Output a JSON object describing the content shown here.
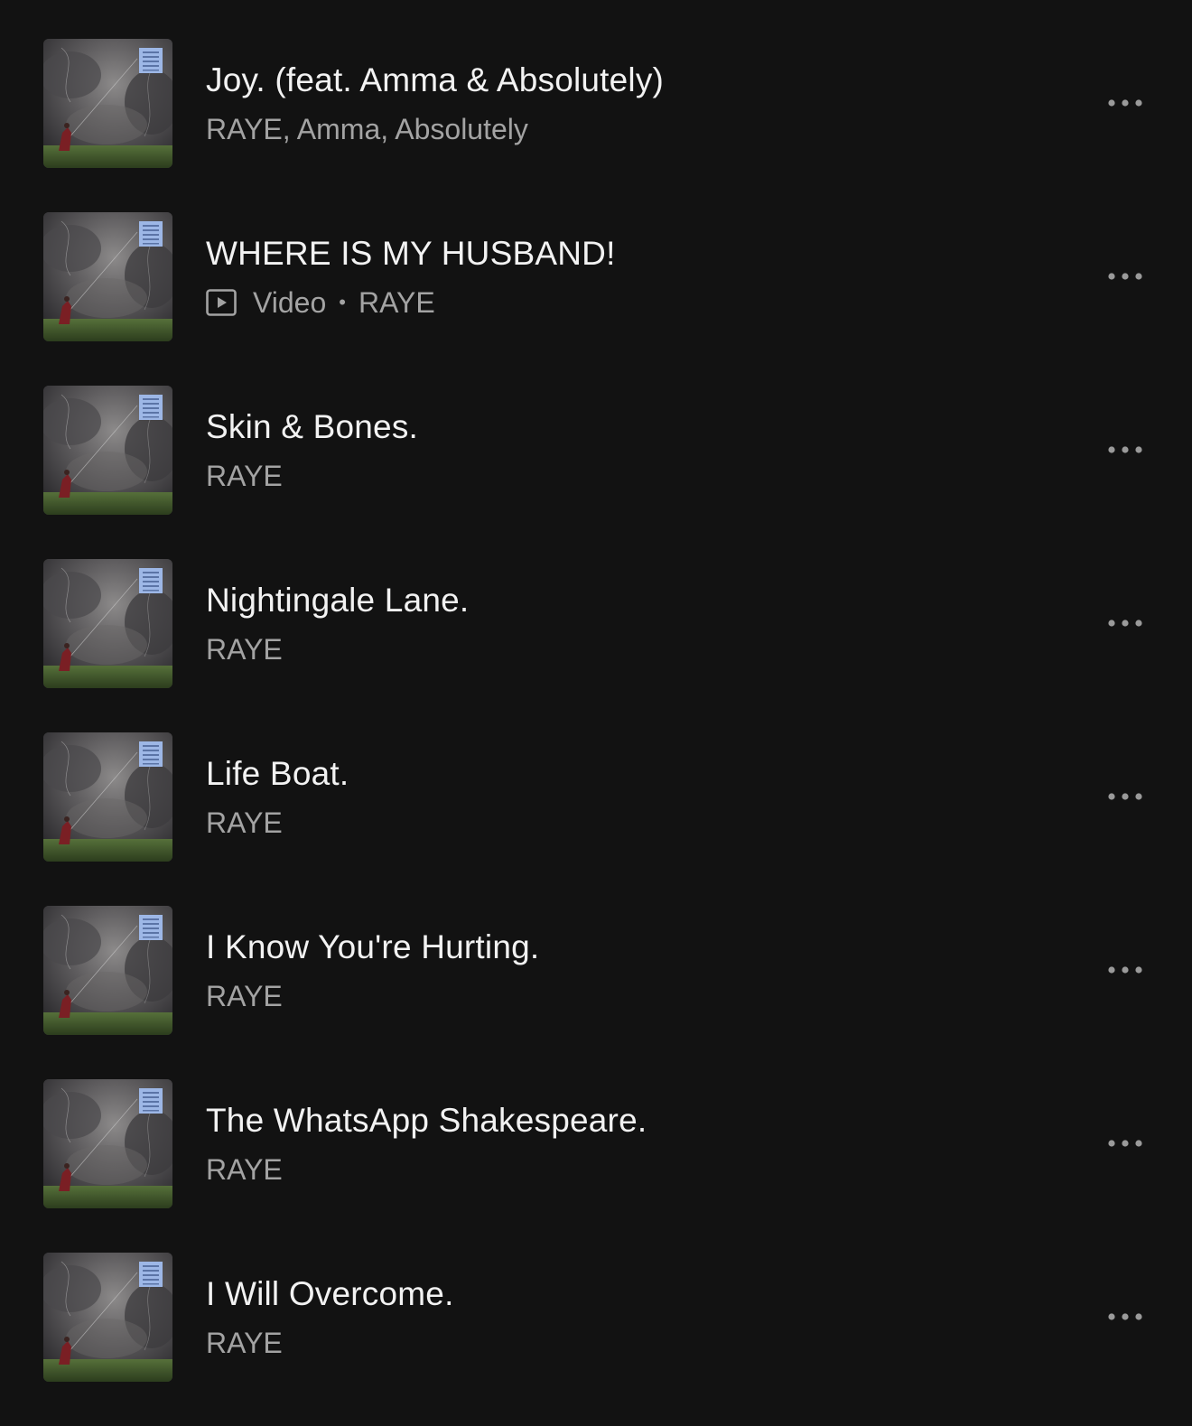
{
  "colors": {
    "background": "#121212",
    "title_text": "#f2f2f2",
    "subtitle_text": "#a3a3a3",
    "more_icon": "#9a9a9a"
  },
  "cover_icon": "album-cover-image",
  "more_icon": "more-horizontal-icon",
  "video_icon": "video-play-icon",
  "tracks": [
    {
      "title": "Joy. (feat. Amma & Absolutely)",
      "artist": "RAYE, Amma, Absolutely"
    },
    {
      "title": "WHERE IS MY HUSBAND!",
      "type_label": "Video",
      "separator": "•",
      "artist": "RAYE"
    },
    {
      "title": "Skin & Bones.",
      "artist": "RAYE"
    },
    {
      "title": "Nightingale Lane.",
      "artist": "RAYE"
    },
    {
      "title": "Life Boat.",
      "artist": "RAYE"
    },
    {
      "title": "I Know You're Hurting.",
      "artist": "RAYE"
    },
    {
      "title": "The WhatsApp Shakespeare.",
      "artist": "RAYE"
    },
    {
      "title": "I Will Overcome.",
      "artist": "RAYE"
    }
  ]
}
